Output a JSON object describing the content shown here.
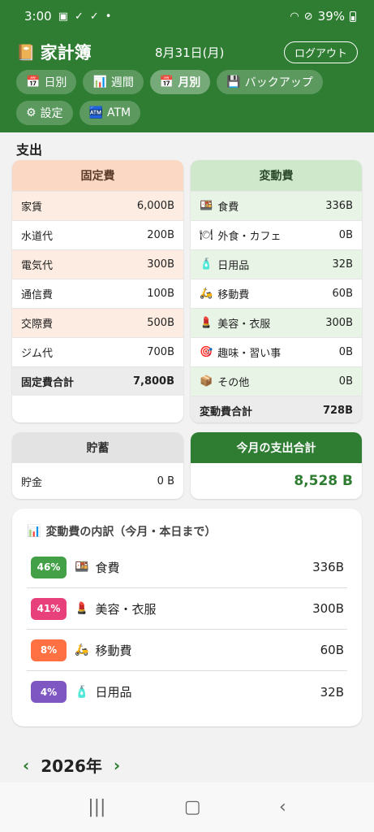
{
  "status": {
    "time": "3:00",
    "battery": "39%"
  },
  "header": {
    "title": "家計簿",
    "date": "8月31日(月)",
    "logout_label": "ログアウト",
    "accent_color": "#2e7d32"
  },
  "tabs": [
    {
      "label": "日別",
      "icon": "calendar-icon"
    },
    {
      "label": "週間",
      "icon": "bar-chart-icon"
    },
    {
      "label": "月別",
      "icon": "calendar-icon",
      "active": true
    },
    {
      "label": "バックアップ",
      "icon": "floppy-disk-icon"
    },
    {
      "label": "設定",
      "icon": "gear-icon"
    },
    {
      "label": "ATM",
      "icon": "atm-icon"
    }
  ],
  "section_title": "支出",
  "fixed": {
    "title": "固定費",
    "items": [
      {
        "label": "家賃",
        "value": "6,000B"
      },
      {
        "label": "水道代",
        "value": "200B"
      },
      {
        "label": "電気代",
        "value": "300B"
      },
      {
        "label": "通信費",
        "value": "100B"
      },
      {
        "label": "交際費",
        "value": "500B"
      },
      {
        "label": "ジム代",
        "value": "700B"
      }
    ],
    "total_label": "固定費合計",
    "total_value": "7,800B"
  },
  "variable": {
    "title": "変動費",
    "items": [
      {
        "label": "食費",
        "value": "336B",
        "icon": "bento-icon"
      },
      {
        "label": "外食・カフェ",
        "value": "0B",
        "icon": "plate-icon"
      },
      {
        "label": "日用品",
        "value": "32B",
        "icon": "bottle-icon"
      },
      {
        "label": "移動費",
        "value": "60B",
        "icon": "scooter-icon"
      },
      {
        "label": "美容・衣服",
        "value": "300B",
        "icon": "lipstick-icon"
      },
      {
        "label": "趣味・習い事",
        "value": "0B",
        "icon": "target-icon"
      },
      {
        "label": "その他",
        "value": "0B",
        "icon": "package-icon"
      }
    ],
    "total_label": "変動費合計",
    "total_value": "728B"
  },
  "savings": {
    "title": "貯蓄",
    "label": "貯金",
    "value": "0 B"
  },
  "month_total": {
    "title": "今月の支出合計",
    "value": "8,528 B"
  },
  "breakdown": {
    "title": "変動費の内訳（今月・本日まで）",
    "items": [
      {
        "percent": "46%",
        "label": "食費",
        "value": "336B",
        "color": "#43a047",
        "icon": "bento-icon"
      },
      {
        "percent": "41%",
        "label": "美容・衣服",
        "value": "300B",
        "color": "#e8407a",
        "icon": "lipstick-icon"
      },
      {
        "percent": "8%",
        "label": "移動費",
        "value": "60B",
        "color": "#ff7043",
        "icon": "scooter-icon"
      },
      {
        "percent": "4%",
        "label": "日用品",
        "value": "32B",
        "color": "#7e57c2",
        "icon": "bottle-icon"
      }
    ]
  },
  "year_nav": {
    "year": "2026年",
    "prev": "‹",
    "next": "›"
  }
}
